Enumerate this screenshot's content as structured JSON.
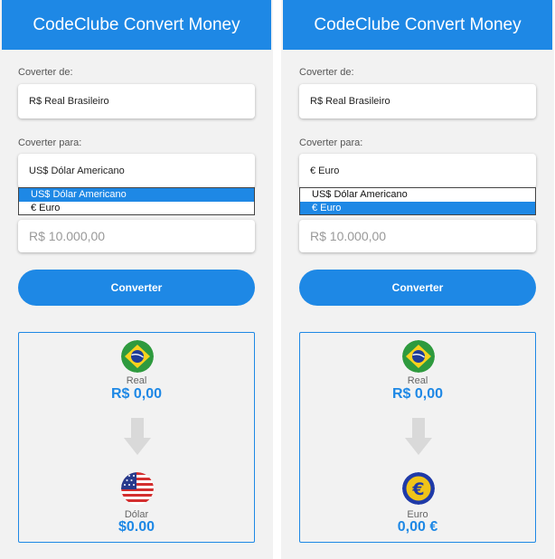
{
  "panels": [
    {
      "title": "CodeClube Convert Money",
      "from_label": "Coverter de:",
      "from_value": "R$ Real Brasileiro",
      "to_label": "Coverter para:",
      "to_value": "US$ Dólar Americano",
      "options": [
        "US$ Dólar Americano",
        "€ Euro"
      ],
      "selected_option": "US$ Dólar Americano",
      "amount_placeholder": "R$ 10.000,00",
      "convert_label": "Converter",
      "result": {
        "from_currency": "Real",
        "from_amount": "R$ 0,00",
        "to_currency": "Dólar",
        "to_amount": "$0.00",
        "from_flag": "brazil-flag-icon",
        "to_flag": "usa-flag-icon"
      }
    },
    {
      "title": "CodeClube Convert Money",
      "from_label": "Coverter de:",
      "from_value": "R$ Real Brasileiro",
      "to_label": "Coverter para:",
      "to_value": "€ Euro",
      "options": [
        "US$ Dólar Americano",
        "€ Euro"
      ],
      "selected_option": "€ Euro",
      "amount_placeholder": "R$ 10.000,00",
      "convert_label": "Converter",
      "result": {
        "from_currency": "Real",
        "from_amount": "R$ 0,00",
        "to_currency": "Euro",
        "to_amount": "0,00 €",
        "from_flag": "brazil-flag-icon",
        "to_flag": "euro-flag-icon"
      }
    }
  ],
  "colors": {
    "accent": "#1e88e5",
    "panel_bg": "#f2f2f2",
    "arrow": "#d9d9d9"
  }
}
